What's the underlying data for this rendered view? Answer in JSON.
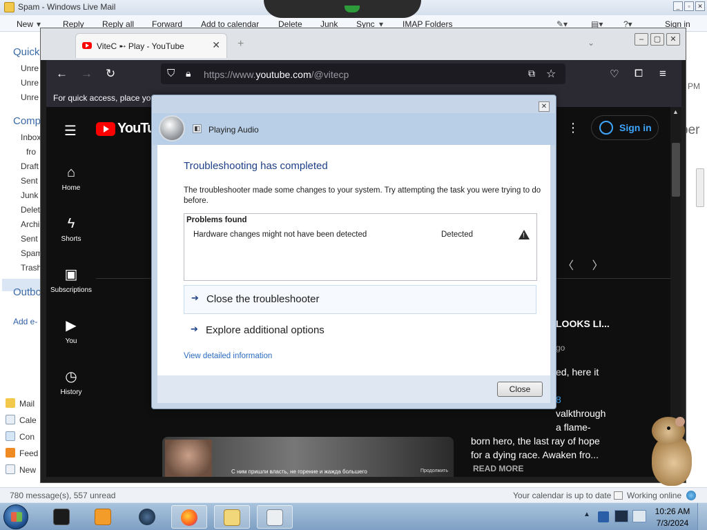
{
  "wlm": {
    "title": "Spam - Windows Live Mail",
    "toolbar": {
      "new": "New",
      "reply": "Reply",
      "reply_all": "Reply all",
      "forward": "Forward",
      "add_to_calendar": "Add to calendar",
      "delete": "Delete",
      "junk": "Junk",
      "sync": "Sync",
      "imap_folders": "IMAP Folders",
      "sign_in": "Sign in"
    },
    "nav": {
      "quick_views": "Quick",
      "unread1": "Unre",
      "unread2": "Unre",
      "unread3": "Unre",
      "account": "Comp",
      "inbox": "Inbox",
      "from": "fro",
      "drafts": "Draft",
      "sent1": "Sent",
      "junk": "Junk",
      "deleted": "Delet",
      "archive": "Archi",
      "sent2": "Sent",
      "spam": "Spam",
      "trash": "Trash",
      "outbox": "Outbo",
      "add_email": "Add e-"
    },
    "apps": {
      "mail": "Mail",
      "calendar": "Cale",
      "contacts": "Con",
      "feeds": "Feed",
      "newsgroups": "New"
    },
    "right_time": "PM",
    "right_text": "per",
    "status_left": "780 message(s), 557 unread",
    "status_calendar": "Your calendar is up to date",
    "status_online": "Working online"
  },
  "firefox": {
    "tab_title": "ViteC ➸ Play - YouTube",
    "url_prefix": "https://www.",
    "url_domain": "youtube.com",
    "url_path": "/@vitecp",
    "bookmarks_hint": "For quick access, place you"
  },
  "youtube": {
    "logo": "YouTube",
    "sidebar": [
      {
        "label": "Home",
        "icon": "home-icon"
      },
      {
        "label": "Shorts",
        "icon": "shorts-icon"
      },
      {
        "label": "Subscriptions",
        "icon": "subscriptions-icon"
      },
      {
        "label": "You",
        "icon": "you-icon"
      },
      {
        "label": "History",
        "icon": "history-icon"
      }
    ],
    "sign_in": "Sign in",
    "video_title_fragment": "LOOKS LI...",
    "time_ago": "go",
    "desc_fragment1": "ed, here it",
    "desc_fragment2": "8",
    "desc_lines": [
      "valkthrough",
      "a flame-",
      "born hero, the last ray of hope",
      "for a dying race. Awaken fro..."
    ],
    "read_more": "READ MORE",
    "video_subtitle": "С ним пришли власть, не горение и жажда большего",
    "video_watermark": "Продолжить"
  },
  "dialog": {
    "title": "Playing Audio",
    "heading": "Troubleshooting has completed",
    "message": "The troubleshooter made some changes to your system. Try attempting the task you were trying to do before.",
    "problems_header": "Problems found",
    "problem_description": "Hardware changes might not have been detected",
    "problem_status": "Detected",
    "option_close": "Close the troubleshooter",
    "option_explore": "Explore additional options",
    "details_link": "View detailed information",
    "close_button": "Close"
  },
  "taskbar": {
    "time": "10:26 AM",
    "date": "7/3/2024"
  },
  "colors": {
    "yt_red": "#ff0000",
    "yt_blue": "#3ea6ff",
    "dialog_heading": "#1d3f87",
    "link": "#2a6bbf"
  }
}
